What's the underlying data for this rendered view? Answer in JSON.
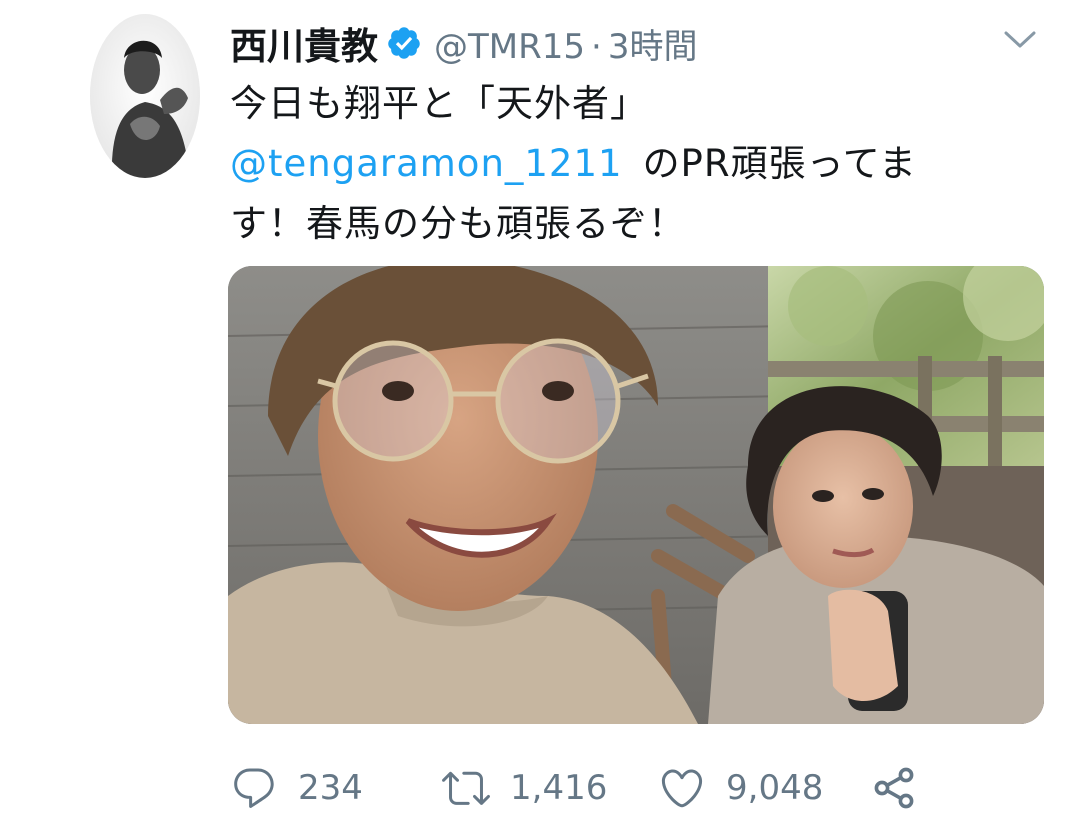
{
  "tweet": {
    "author_name": "西川貴教",
    "handle": "@TMR15",
    "separator": "·",
    "time": "3時間",
    "text_line1": "今日も翔平と「天外者」",
    "mention": "@tengaramon_1211",
    "text_line2_rest": "のPR頑張ってま",
    "text_line3": "す！春馬の分も頑張るぞ！",
    "media_icon": "photo",
    "avatar_icon": "profile-photo"
  },
  "actions": {
    "reply_count": "234",
    "retweet_count": "1,416",
    "like_count": "9,048"
  },
  "colors": {
    "link": "#1da1f2",
    "verified": "#1da1f2",
    "meta": "#657786",
    "text": "#14171a"
  }
}
